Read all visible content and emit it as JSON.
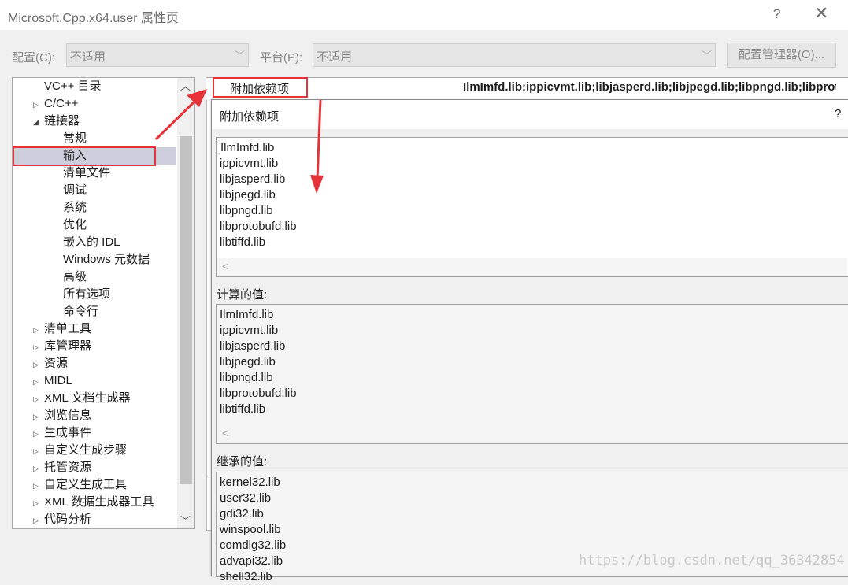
{
  "window": {
    "title": "Microsoft.Cpp.x64.user 属性页",
    "help_glyph": "?",
    "close_glyph": "✕"
  },
  "toolbar": {
    "config_label": "配置(C):",
    "config_value": "不适用",
    "platform_label": "平台(P):",
    "platform_value": "不适用",
    "config_manager_label": "配置管理器(O)..."
  },
  "tree": {
    "items": [
      {
        "label": "VC++ 目录"
      },
      {
        "label": "C/C++"
      },
      {
        "label": "链接器"
      },
      {
        "label": "常规"
      },
      {
        "label": "输入"
      },
      {
        "label": "清单文件"
      },
      {
        "label": "调试"
      },
      {
        "label": "系统"
      },
      {
        "label": "优化"
      },
      {
        "label": "嵌入的 IDL"
      },
      {
        "label": "Windows 元数据"
      },
      {
        "label": "高级"
      },
      {
        "label": "所有选项"
      },
      {
        "label": "命令行"
      },
      {
        "label": "清单工具"
      },
      {
        "label": "库管理器"
      },
      {
        "label": "资源"
      },
      {
        "label": "MIDL"
      },
      {
        "label": "XML 文档生成器"
      },
      {
        "label": "浏览信息"
      },
      {
        "label": "生成事件"
      },
      {
        "label": "自定义生成步骤"
      },
      {
        "label": "托管资源"
      },
      {
        "label": "自定义生成工具"
      },
      {
        "label": "XML 数据生成器工具"
      },
      {
        "label": "代码分析"
      }
    ],
    "selected": "输入"
  },
  "property": {
    "name": "附加依赖项",
    "value": "IlmImfd.lib;ippicvmt.lib;libjasperd.lib;libjpegd.lib;libpngd.lib;libprotobufd.lib;libtiffd.lib"
  },
  "dialog": {
    "title": "附加依赖项",
    "help": "?",
    "edit_lines": [
      "IlmImfd.lib",
      "ippicvmt.lib",
      "libjasperd.lib",
      "libjpegd.lib",
      "libpngd.lib",
      "libprotobufd.lib",
      "libtiffd.lib"
    ],
    "computed_label": "计算的值:",
    "computed_lines": [
      "IlmImfd.lib",
      "ippicvmt.lib",
      "libjasperd.lib",
      "libjpegd.lib",
      "libpngd.lib",
      "libprotobufd.lib",
      "libtiffd.lib"
    ],
    "inherited_label": "继承的值:",
    "inherited_lines": [
      "kernel32.lib",
      "user32.lib",
      "gdi32.lib",
      "winspool.lib",
      "comdlg32.lib",
      "advapi32.lib",
      "shell32.lib"
    ]
  },
  "icons": {
    "scroll_left": "chevron-left-icon",
    "scroll_up": "chevron-up-icon",
    "scroll_down": "chevron-down-icon",
    "expand": "triangle-right-icon",
    "collapse": "triangle-down-icon"
  },
  "colors": {
    "highlight": "#e8323a",
    "selection": "#cccedb"
  },
  "watermark": "https://blog.csdn.net/qq_36342854"
}
